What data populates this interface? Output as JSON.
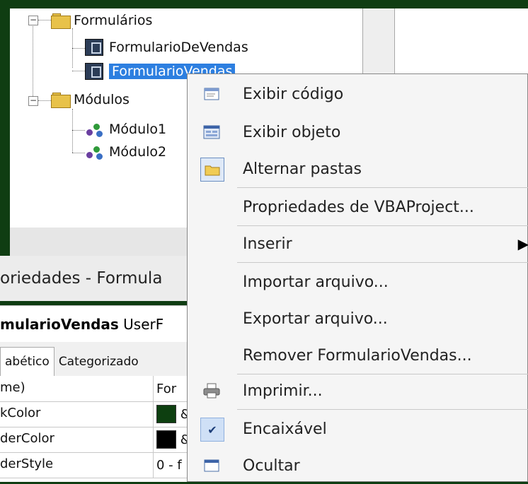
{
  "project_tree": {
    "folders": [
      {
        "label": "Formulários",
        "children": [
          "FormularioDeVendas",
          "FormularioVendas"
        ],
        "selected_child": 1
      },
      {
        "label": "Módulos",
        "children": [
          "Módulo1",
          "Módulo2"
        ]
      }
    ],
    "expander_symbol": "−"
  },
  "properties": {
    "title": "oriedades - Formula",
    "object_name": "mularioVendas",
    "object_type": "UserF",
    "tabs": [
      "abético",
      "Categorizado"
    ],
    "rows": [
      {
        "name": "me)",
        "value": "For"
      },
      {
        "name": "kColor",
        "value": "&",
        "swatch": "#0d3f10"
      },
      {
        "name": "derColor",
        "value": "&",
        "swatch": "#000000"
      },
      {
        "name": "derStyle",
        "value": "0 - f"
      }
    ]
  },
  "context_menu": {
    "items": [
      {
        "label": "Exibir código",
        "icon": "view-code-icon"
      },
      {
        "label": "Exibir objeto",
        "icon": "view-object-icon"
      },
      {
        "label": "Alternar pastas",
        "icon": "toggle-folders-icon"
      },
      {
        "label": "Propriedades de VBAProject...",
        "icon": ""
      },
      {
        "label": "Inserir",
        "icon": "",
        "submenu": true
      },
      {
        "label": "Importar arquivo...",
        "icon": ""
      },
      {
        "label": "Exportar arquivo...",
        "icon": ""
      },
      {
        "label": "Remover FormularioVendas...",
        "icon": ""
      },
      {
        "label": "Imprimir...",
        "icon": "printer-icon"
      },
      {
        "label": "Encaixável",
        "icon": "checkmark-icon",
        "checked": true
      },
      {
        "label": "Ocultar",
        "icon": "hide-window-icon"
      }
    ],
    "submenu_arrow": "▶",
    "check_glyph": "✔"
  },
  "colors": {
    "background": "#0f3d12",
    "selection": "#2d7fe0",
    "menu_bg": "#f5f5f5"
  }
}
